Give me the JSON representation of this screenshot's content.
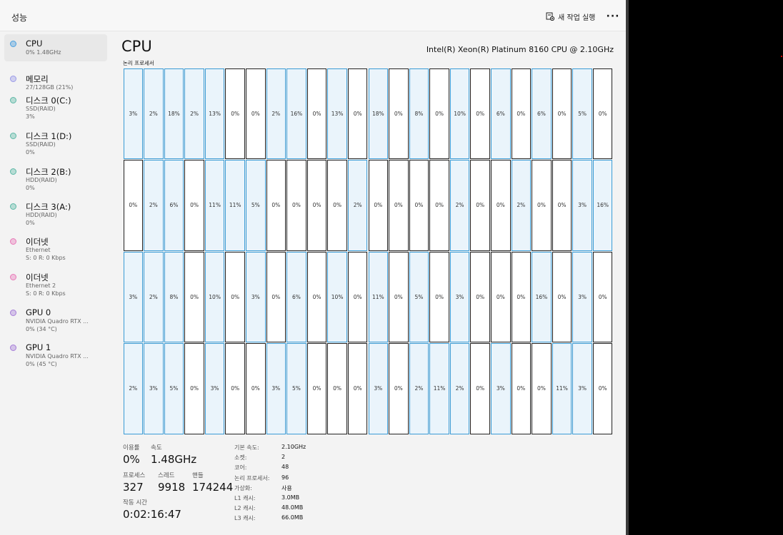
{
  "header": {
    "title": "성능",
    "new_task_label": "새 작업 실행",
    "more_label": "···"
  },
  "sidebar": {
    "items": [
      {
        "name": "CPU",
        "sub1": "0%  1.48GHz",
        "sub2": "",
        "color": "#4aa0e0",
        "selected": true
      },
      {
        "name": "메모리",
        "sub1": "27/128GB (21%)",
        "sub2": "",
        "color": "#9a9ae8",
        "selected": false
      },
      {
        "name": "디스크 0(C:)",
        "sub1": "SSD(RAID)",
        "sub2": "3%",
        "color": "#5cb8a6",
        "selected": false
      },
      {
        "name": "디스크 1(D:)",
        "sub1": "SSD(RAID)",
        "sub2": "0%",
        "color": "#5cb8a6",
        "selected": false
      },
      {
        "name": "디스크 2(B:)",
        "sub1": "HDD(RAID)",
        "sub2": "0%",
        "color": "#5cb8a6",
        "selected": false
      },
      {
        "name": "디스크 3(A:)",
        "sub1": "HDD(RAID)",
        "sub2": "0%",
        "color": "#5cb8a6",
        "selected": false
      },
      {
        "name": "이더넷",
        "sub1": "Ethernet",
        "sub2": "S: 0  R: 0 Kbps",
        "color": "#e879b8",
        "selected": false
      },
      {
        "name": "이더넷",
        "sub1": "Ethernet 2",
        "sub2": "S: 0  R: 0 Kbps",
        "color": "#e879b8",
        "selected": false
      },
      {
        "name": "GPU 0",
        "sub1": "NVIDIA Quadro RTX ...",
        "sub2": "0%  (34 °C)",
        "color": "#a67cd8",
        "selected": false
      },
      {
        "name": "GPU 1",
        "sub1": "NVIDIA Quadro RTX ...",
        "sub2": "0%  (45 °C)",
        "color": "#a67cd8",
        "selected": false
      }
    ]
  },
  "main": {
    "title": "CPU",
    "model": "Intel(R) Xeon(R) Platinum 8160 CPU @ 2.10GHz",
    "grid_label": "논리 프로세서",
    "colors": {
      "border": "#3a9bd5",
      "fill": "#eaf4fb",
      "highlight_border": "#222222"
    },
    "processors": [
      [
        "3%",
        "2%",
        "18%",
        "2%",
        "13%",
        "0%",
        "0%",
        "2%",
        "16%",
        "0%",
        "13%",
        "0%",
        "18%",
        "0%",
        "8%",
        "0%",
        "10%",
        "0%",
        "6%",
        "0%",
        "6%",
        "0%",
        "5%",
        "0%"
      ],
      [
        "0%",
        "2%",
        "6%",
        "0%",
        "11%",
        "11%",
        "5%",
        "0%",
        "0%",
        "0%",
        "0%",
        "2%",
        "0%",
        "0%",
        "0%",
        "0%",
        "2%",
        "0%",
        "0%",
        "2%",
        "0%",
        "0%",
        "3%",
        "16%"
      ],
      [
        "3%",
        "2%",
        "8%",
        "0%",
        "10%",
        "0%",
        "3%",
        "0%",
        "6%",
        "0%",
        "10%",
        "0%",
        "11%",
        "0%",
        "5%",
        "0%",
        "3%",
        "0%",
        "0%",
        "0%",
        "16%",
        "0%",
        "3%",
        "0%"
      ],
      [
        "2%",
        "3%",
        "5%",
        "0%",
        "3%",
        "0%",
        "0%",
        "3%",
        "5%",
        "0%",
        "0%",
        "0%",
        "3%",
        "0%",
        "2%",
        "11%",
        "2%",
        "0%",
        "3%",
        "0%",
        "0%",
        "11%",
        "3%",
        "0%"
      ]
    ],
    "highlighted": [
      [
        0,
        0,
        0,
        0,
        0,
        1,
        1,
        0,
        0,
        1,
        0,
        1,
        0,
        1,
        0,
        1,
        0,
        1,
        0,
        1,
        0,
        1,
        0,
        1
      ],
      [
        1,
        0,
        0,
        1,
        0,
        0,
        0,
        1,
        1,
        1,
        1,
        0,
        1,
        1,
        1,
        1,
        0,
        1,
        1,
        0,
        1,
        1,
        0,
        0
      ],
      [
        0,
        0,
        0,
        1,
        0,
        1,
        0,
        1,
        0,
        1,
        0,
        1,
        0,
        1,
        0,
        1,
        0,
        1,
        1,
        1,
        0,
        1,
        0,
        1
      ],
      [
        0,
        0,
        0,
        1,
        0,
        1,
        1,
        0,
        0,
        1,
        1,
        1,
        0,
        1,
        0,
        0,
        0,
        1,
        0,
        1,
        1,
        0,
        0,
        1
      ]
    ]
  },
  "stats": {
    "utilization_label": "이용률",
    "utilization": "0%",
    "speed_label": "속도",
    "speed": "1.48GHz",
    "processes_label": "프로세스",
    "processes": "327",
    "threads_label": "스레드",
    "threads": "9918",
    "handles_label": "핸들",
    "handles": "174244",
    "uptime_label": "작동 시간",
    "uptime": "0:02:16:47"
  },
  "specs": [
    {
      "key": "기본 속도:",
      "value": "2.10GHz"
    },
    {
      "key": "소켓:",
      "value": "2"
    },
    {
      "key": "코어:",
      "value": "48"
    },
    {
      "key": "논리 프로세서:",
      "value": "96"
    },
    {
      "key": "가상화:",
      "value": "사용"
    },
    {
      "key": "L1 캐시:",
      "value": "3.0MB"
    },
    {
      "key": "L2 캐시:",
      "value": "48.0MB"
    },
    {
      "key": "L3 캐시:",
      "value": "66.0MB"
    }
  ]
}
